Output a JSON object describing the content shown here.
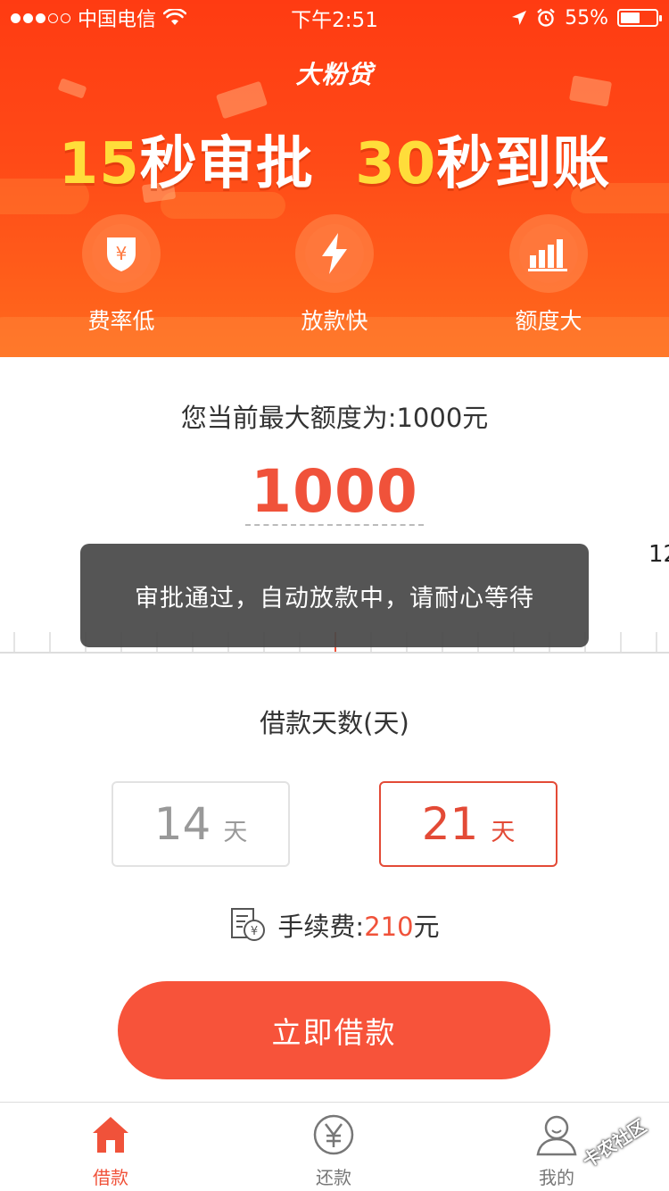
{
  "status_bar": {
    "carrier": "中国电信",
    "time": "下午2:51",
    "battery_percent": "55%",
    "battery_level": 0.55,
    "signal_bars_filled": 3,
    "signal_bars_total": 5
  },
  "header": {
    "logo": "大粉贷",
    "slogan": {
      "part1_number": "15",
      "part1_text": "秒审批",
      "part2_number": "30",
      "part2_text": "秒到账"
    },
    "features": [
      {
        "label": "费率低",
        "icon": "shield-yen-icon"
      },
      {
        "label": "放款快",
        "icon": "lightning-icon"
      },
      {
        "label": "额度大",
        "icon": "bar-chart-icon"
      }
    ]
  },
  "main": {
    "limit_text": "您当前最大额度为:1000元",
    "amount": "1000",
    "ruler_label": "12",
    "toast": "审批通过，自动放款中，请耐心等待",
    "days_title": "借款天数(天)",
    "day_options": [
      {
        "value": "14",
        "unit": "天",
        "selected": false
      },
      {
        "value": "21",
        "unit": "天",
        "selected": true
      }
    ],
    "fee_label": "手续费:",
    "fee_value": "210",
    "fee_unit": "元",
    "loan_button": "立即借款"
  },
  "tabbar": {
    "tabs": [
      {
        "label": "借款",
        "icon": "home-icon",
        "active": true
      },
      {
        "label": "还款",
        "icon": "yen-circle-icon",
        "active": false
      },
      {
        "label": "我的",
        "icon": "user-icon",
        "active": false
      }
    ]
  },
  "watermark": "卡农社区",
  "colors": {
    "brand_orange": "#ff4a17",
    "accent_red": "#f0523a",
    "slogan_yellow": "#ffdd3a"
  }
}
